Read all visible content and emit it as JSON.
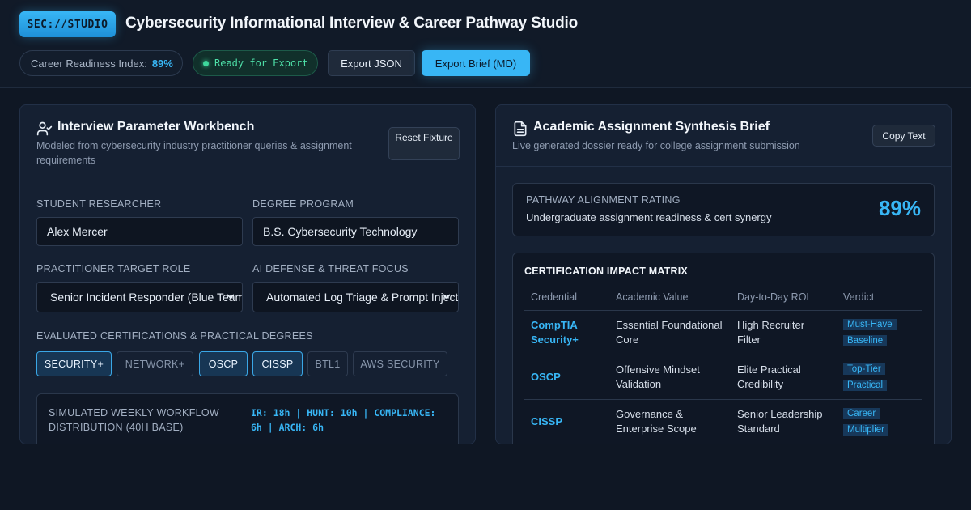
{
  "header": {
    "logo_text": "SEC://STUDIO",
    "title": "Cybersecurity Informational Interview & Career Pathway Studio",
    "readiness_label": "Career Readiness Index:",
    "readiness_value": "89%",
    "status_badge": "Ready for Export",
    "export_json_label": "Export JSON",
    "export_md_label": "Export Brief (MD)"
  },
  "workbench": {
    "icon": "user-check-icon",
    "title": "Interview Parameter Workbench",
    "subtitle": "Modeled from cybersecurity industry practitioner queries & assignment requirements",
    "reset_label": "Reset Fixture",
    "student_label": "Student Researcher",
    "student_value": "Alex Mercer",
    "degree_label": "Degree Program",
    "degree_value": "B.S. Cybersecurity Technology",
    "role_label": "Practitioner Target Role",
    "role_value": "Senior Incident Responder (Blue Team)",
    "focus_label": "AI Defense & Threat Focus",
    "focus_value": "Automated Log Triage & Prompt Injection",
    "certs_label": "Evaluated Certifications & Practical Degrees",
    "certs": [
      {
        "label": "Security+",
        "selected": true
      },
      {
        "label": "Network+",
        "selected": false
      },
      {
        "label": "OSCP",
        "selected": true
      },
      {
        "label": "CISSP",
        "selected": true
      },
      {
        "label": "BTL1",
        "selected": false
      },
      {
        "label": "AWS Security",
        "selected": false
      }
    ],
    "workflow_label": "Simulated Weekly Workflow Distribution (40h Base)",
    "workflow_value": "IR: 18h | HUNT: 10h | COMPLIANCE: 6h | ARCH: 6h"
  },
  "brief": {
    "icon": "document-icon",
    "title": "Academic Assignment Synthesis Brief",
    "subtitle": "Live generated dossier ready for college assignment submission",
    "copy_label": "Copy Text",
    "rating_label": "Pathway Alignment Rating",
    "rating_sub": "Undergraduate assignment readiness & cert synergy",
    "rating_value": "89%",
    "matrix_title": "Certification Impact Matrix",
    "matrix_headers": [
      "Credential",
      "Academic Value",
      "Day-to-Day ROI",
      "Verdict"
    ],
    "matrix_rows": [
      {
        "credential": "CompTIA Security+",
        "value": "Essential Foundational Core",
        "roi": "High Recruiter Filter",
        "verdict": "Must-Have Baseline"
      },
      {
        "credential": "OSCP",
        "value": "Offensive Mindset Validation",
        "roi": "Elite Practical Credibility",
        "verdict": "Top-Tier Practical"
      },
      {
        "credential": "CISSP",
        "value": "Governance & Enterprise Scope",
        "roi": "Senior Leadership Standard",
        "verdict": "Career Multiplier"
      }
    ]
  },
  "colors": {
    "accent": "#38b6f5",
    "background": "#0f1724",
    "panel": "#152032",
    "success": "#3ed89c"
  }
}
